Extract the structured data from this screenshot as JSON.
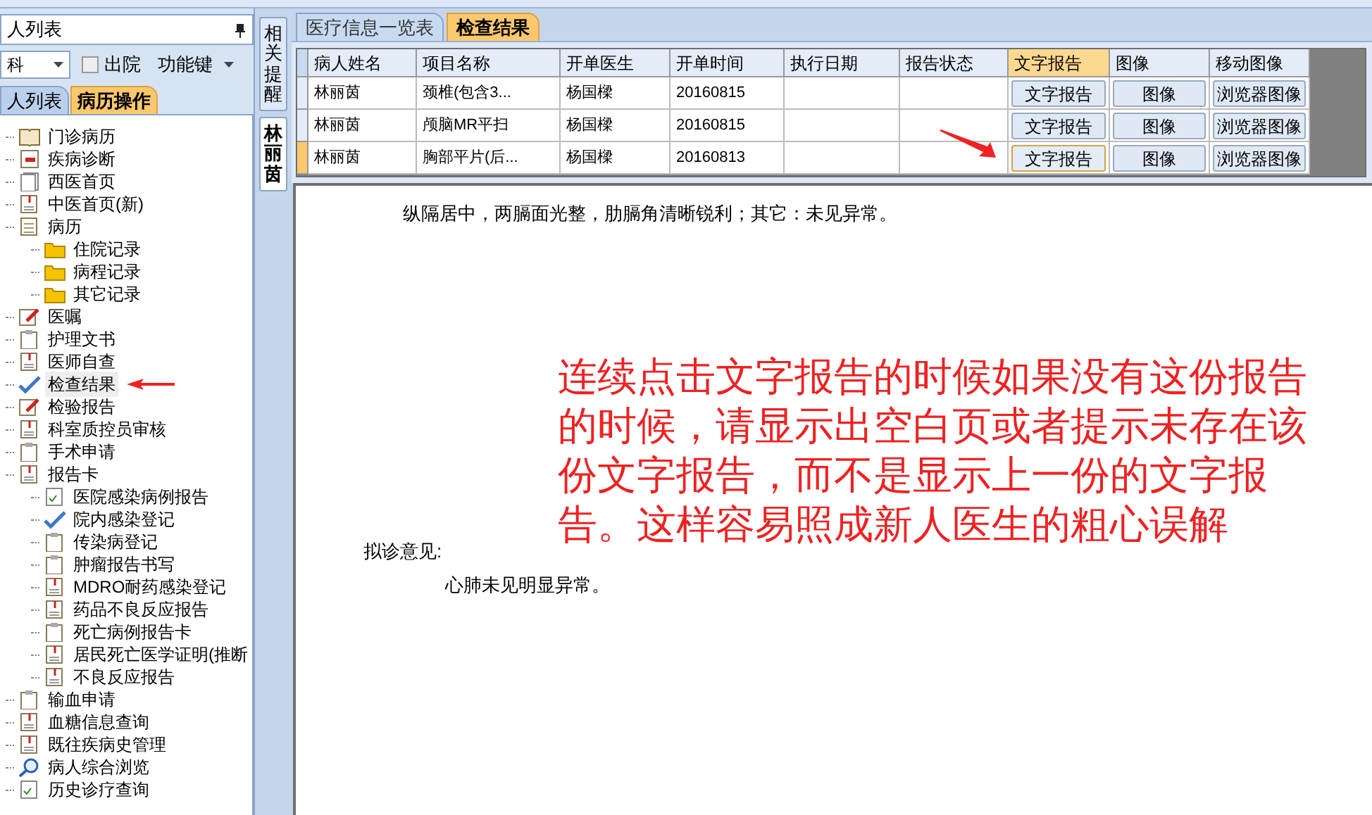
{
  "left_panel": {
    "title": "人列表",
    "department": "科",
    "discharged": {
      "label": "出院",
      "checked": false
    },
    "function_key": "功能键",
    "tabs": [
      {
        "label": "人列表",
        "selected": false
      },
      {
        "label": "病历操作",
        "selected": true
      }
    ],
    "tree": [
      {
        "label": "门诊病历",
        "kind": "book",
        "highlighted": false
      },
      {
        "label": "疾病诊断",
        "kind": "calendar",
        "highlighted": false
      },
      {
        "label": "西医首页",
        "kind": "pages",
        "highlighted": false
      },
      {
        "label": "中医首页(新)",
        "kind": "clip",
        "highlighted": false
      },
      {
        "label": "病历",
        "kind": "notepad",
        "highlighted": false,
        "children": [
          {
            "label": "住院记录",
            "kind": "folder",
            "highlighted": false
          },
          {
            "label": "病程记录",
            "kind": "folder",
            "highlighted": false
          },
          {
            "label": "其它记录",
            "kind": "folder",
            "highlighted": false
          }
        ]
      },
      {
        "label": "医嘱",
        "kind": "edit",
        "highlighted": false
      },
      {
        "label": "护理文书",
        "kind": "clipboard",
        "highlighted": false
      },
      {
        "label": "医师自查",
        "kind": "clip",
        "highlighted": false
      },
      {
        "label": "检查结果",
        "kind": "check",
        "highlighted": true
      },
      {
        "label": "检验报告",
        "kind": "edit",
        "highlighted": false
      },
      {
        "label": "科室质控员审核",
        "kind": "clip",
        "highlighted": false
      },
      {
        "label": "手术申请",
        "kind": "clipboard",
        "highlighted": false
      },
      {
        "label": "报告卡",
        "kind": "clip",
        "highlighted": false,
        "children": [
          {
            "label": "医院感染病例报告",
            "kind": "checklist",
            "highlighted": false
          },
          {
            "label": "院内感染登记",
            "kind": "check",
            "highlighted": false
          },
          {
            "label": "传染病登记",
            "kind": "clipboard",
            "highlighted": false
          },
          {
            "label": "肿瘤报告书写",
            "kind": "clipboard",
            "highlighted": false
          },
          {
            "label": "MDRO耐药感染登记",
            "kind": "clip",
            "highlighted": false
          },
          {
            "label": "药品不良反应报告",
            "kind": "clip",
            "highlighted": false
          },
          {
            "label": "死亡病例报告卡",
            "kind": "clipboard",
            "highlighted": false
          },
          {
            "label": "居民死亡医学证明(推断",
            "kind": "clip",
            "highlighted": false
          },
          {
            "label": "不良反应报告",
            "kind": "clip",
            "highlighted": false
          }
        ]
      },
      {
        "label": "输血申请",
        "kind": "clipboard",
        "highlighted": false
      },
      {
        "label": "血糖信息查询",
        "kind": "clip",
        "highlighted": false
      },
      {
        "label": "既往疾病史管理",
        "kind": "clip",
        "highlighted": false
      },
      {
        "label": "病人综合浏览",
        "kind": "search",
        "highlighted": false
      },
      {
        "label": "历史诊疗查询",
        "kind": "checklist",
        "highlighted": false
      }
    ]
  },
  "side_tabs": [
    {
      "label": "相关提醒",
      "selected": false
    },
    {
      "label": "林丽茵",
      "selected": true
    }
  ],
  "main_tabs": [
    {
      "label": "医疗信息一览表",
      "selected": false
    },
    {
      "label": "检查结果",
      "selected": true
    }
  ],
  "table": {
    "columns": [
      {
        "label": "病人姓名",
        "selected": false
      },
      {
        "label": "项目名称",
        "selected": false
      },
      {
        "label": "开单医生",
        "selected": false
      },
      {
        "label": "开单时间",
        "selected": false
      },
      {
        "label": "执行日期",
        "selected": false
      },
      {
        "label": "报告状态",
        "selected": false
      },
      {
        "label": "文字报告",
        "selected": true
      },
      {
        "label": "图像",
        "selected": false
      },
      {
        "label": "移动图像",
        "selected": false
      }
    ],
    "rows": [
      {
        "selected": false,
        "cells": [
          "林丽茵",
          "颈椎(包含3...",
          "杨国樑",
          "20160815",
          "",
          ""
        ],
        "buttons": [
          "文字报告",
          "图像",
          "浏览器图像"
        ]
      },
      {
        "selected": false,
        "cells": [
          "林丽茵",
          "颅脑MR平扫",
          "杨国樑",
          "20160815",
          "",
          ""
        ],
        "buttons": [
          "文字报告",
          "图像",
          "浏览器图像"
        ]
      },
      {
        "selected": true,
        "cells": [
          "林丽茵",
          "胸部平片(后...",
          "杨国樑",
          "20160813",
          "",
          ""
        ],
        "buttons": [
          "文字报告",
          "图像",
          "浏览器图像"
        ]
      }
    ]
  },
  "report": {
    "findings": "纵隔居中，两膈面光整，肋膈角清晰锐利；其它：未见异常。",
    "opinion_label": "拟诊意见:",
    "opinion": "心肺未见明显异常。"
  },
  "annotation": "连续点击文字报告的时候如果没有这份报告的时候，请显示出空白页或者提示未存在该份文字报告，而不是显示上一份的文字报告。这样容易照成新人医生的粗心误解"
}
